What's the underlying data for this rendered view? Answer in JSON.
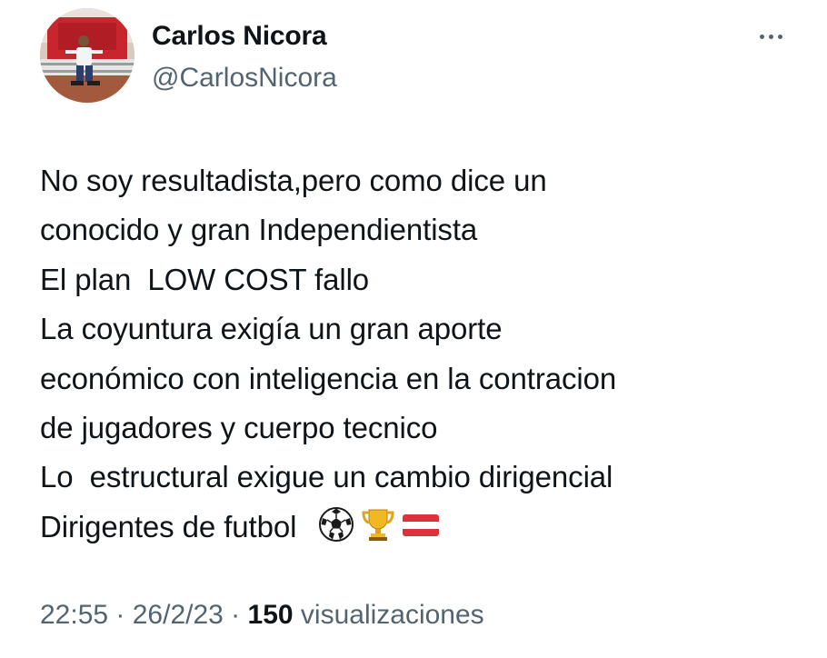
{
  "author": {
    "display_name": "Carlos Nicora",
    "handle": "@CarlosNicora"
  },
  "tweet": {
    "lines": [
      "No soy resultadista,pero como dice un",
      "conocido y gran Independientista",
      "El plan  LOW COST fallo",
      "La coyuntura exigía un gran aporte",
      "económico con inteligencia en la contracion",
      "de jugadores y cuerpo tecnico",
      "Lo  estructural exigue un cambio dirigencial",
      "Dirigentes de futbol  "
    ],
    "emojis": [
      "soccer-ball-icon",
      "trophy-icon",
      "red-white-flag-icon"
    ]
  },
  "meta": {
    "time": "22:55",
    "separator_1": " · ",
    "date": "26/2/23",
    "separator_2": " · ",
    "view_count": "150",
    "view_label": " visualizaciones"
  },
  "colors": {
    "text_primary": "#0f1419",
    "text_secondary": "#536471",
    "background": "#ffffff"
  }
}
